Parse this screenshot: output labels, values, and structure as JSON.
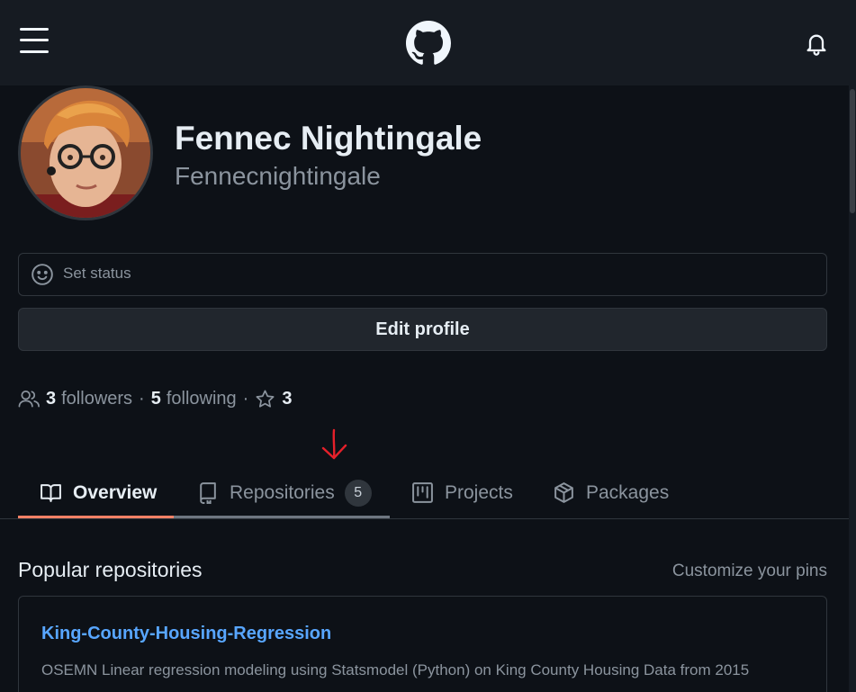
{
  "profile": {
    "full_name": "Fennec Nightingale",
    "username": "Fennecnightingale"
  },
  "status": {
    "label": "Set status"
  },
  "edit_profile": {
    "label": "Edit profile"
  },
  "follow": {
    "followers_count": "3",
    "followers_label": "followers",
    "separator": "·",
    "following_count": "5",
    "following_label": "following",
    "stars_count": "3"
  },
  "tabs": [
    {
      "label": "Overview",
      "icon": "book-icon",
      "active": true
    },
    {
      "label": "Repositories",
      "icon": "repo-icon",
      "counter": "5",
      "active": false
    },
    {
      "label": "Projects",
      "icon": "project-icon",
      "active": false
    },
    {
      "label": "Packages",
      "icon": "package-icon",
      "active": false
    }
  ],
  "popular": {
    "title": "Popular repositories",
    "customize_label": "Customize your pins",
    "repos": [
      {
        "name": "King-County-Housing-Regression",
        "description": "OSEMN Linear regression modeling using Statsmodel (Python) on King County Housing Data from 2015"
      }
    ]
  },
  "icons": {
    "menu": "hamburger-menu-icon",
    "logo": "github-logo-icon",
    "notifications": "bell-icon",
    "status": "smiley-icon",
    "people": "people-icon",
    "star": "star-icon",
    "annotation": "red-arrow-annotation-icon"
  },
  "colors": {
    "background": "#0d1117",
    "header": "#161b22",
    "link": "#58a6ff",
    "active_tab_underline": "#f78166",
    "hover_tab_underline": "#6e7681",
    "annotation": "#e5202a"
  }
}
